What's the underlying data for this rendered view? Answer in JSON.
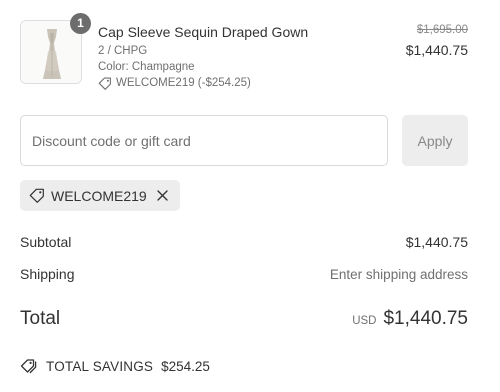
{
  "product": {
    "quantity": "1",
    "name": "Cap Sleeve Sequin Draped Gown",
    "size": "2 / CHPG",
    "color": "Color: Champagne",
    "discount": "WELCOME219 (-$254.25)",
    "original_price": "$1,695.00",
    "final_price": "$1,440.75",
    "image_icon": "gown-thumbnail"
  },
  "discount_form": {
    "placeholder": "Discount code or gift card",
    "value": "",
    "apply_label": "Apply"
  },
  "applied_code": {
    "label": "WELCOME219",
    "icon": "tag-icon",
    "remove_icon": "close-icon"
  },
  "summary": {
    "subtotal_label": "Subtotal",
    "subtotal_value": "$1,440.75",
    "shipping_label": "Shipping",
    "shipping_value": "Enter shipping address",
    "total_label": "Total",
    "total_currency": "USD",
    "total_value": "$1,440.75",
    "savings_label": "TOTAL SAVINGS",
    "savings_value": "$254.25",
    "savings_icon": "tags-icon"
  },
  "colors": {
    "text": "#333333",
    "muted": "#707070",
    "chip_bg": "#ededed",
    "badge_bg": "#6d6d6d",
    "border": "#d9d9d9"
  }
}
